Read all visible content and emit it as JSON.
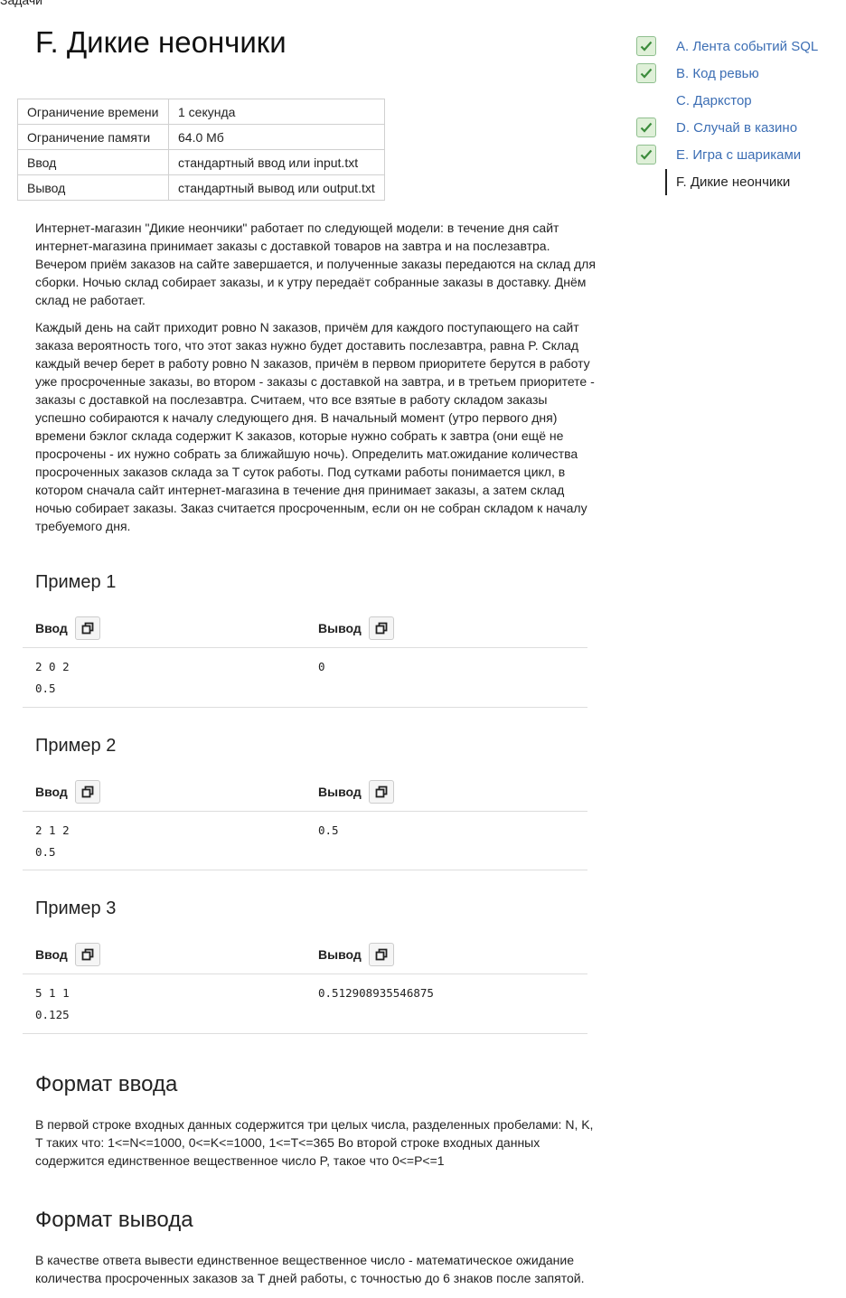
{
  "breadcrumb": "Задачи",
  "title": "F. Дикие неончики",
  "limits": [
    {
      "key": "Ограничение времени",
      "value": "1 секунда"
    },
    {
      "key": "Ограничение памяти",
      "value": "64.0 Мб"
    },
    {
      "key": "Ввод",
      "value": "стандартный ввод или input.txt"
    },
    {
      "key": "Вывод",
      "value": "стандартный вывод или output.txt"
    }
  ],
  "statement": [
    "Интернет-магазин \"Дикие неончики\" работает по следующей модели: в течение дня сайт интернет-магазина принимает заказы с доставкой товаров на завтра и на послезавтра. Вечером приём заказов на сайте завершается, и полученные заказы передаются на склад для сборки. Ночью склад собирает заказы, и к утру передаёт собранные заказы в доставку. Днём склад не работает.",
    "Каждый день на сайт приходит ровно N заказов, причём для каждого поступающего на сайт заказа вероятность того, что этот заказ нужно будет доставить послезавтра, равна P. Склад каждый вечер берет в работу ровно N заказов, причём в первом приоритете берутся в работу уже просроченные заказы, во втором - заказы с доставкой на завтра, и в третьем приоритете - заказы с доставкой на послезавтра. Считаем, что все взятые в работу складом заказы успешно собираются к началу следующего дня. В начальный момент (утро первого дня) времени бэклог склада содержит K заказов, которые нужно собрать к завтра (они ещё не просрочены - их нужно собрать за ближайшую ночь). Определить мат.ожидание количества просроченных заказов склада за T суток работы. Под сутками работы понимается цикл, в котором сначала сайт интернет-магазина в течение дня принимает заказы, а затем склад ночью собирает заказы. Заказ считается просроченным, если он не собран складом к началу требуемого дня."
  ],
  "io_labels": {
    "input": "Ввод",
    "output": "Вывод"
  },
  "examples": [
    {
      "title": "Пример 1",
      "input": [
        "2 0 2",
        "0.5"
      ],
      "output": [
        "0"
      ]
    },
    {
      "title": "Пример 2",
      "input": [
        "2 1 2",
        "0.5"
      ],
      "output": [
        "0.5"
      ]
    },
    {
      "title": "Пример 3",
      "input": [
        "5 1 1",
        "0.125"
      ],
      "output": [
        "0.512908935546875"
      ]
    }
  ],
  "input_format": {
    "heading": "Формат ввода",
    "text": "В первой строке входных данных содержится три целых числа, разделенных пробелами: N, K, T таких что: 1<=N<=1000, 0<=K<=1000, 1<=T<=365 Во второй строке входных данных содержится единственное вещественное число P, такое что 0<=P<=1"
  },
  "output_format": {
    "heading": "Формат вывода",
    "text": "В качестве ответа вывести единственное вещественное число - математическое ожидание количества просроченных заказов за T дней работы, с точностью до 6 знаков после запятой."
  },
  "sidebar": [
    {
      "label": "A. Лента событий SQL",
      "solved": true
    },
    {
      "label": "B. Код ревью",
      "solved": true
    },
    {
      "label": "C. Даркстор",
      "solved": false
    },
    {
      "label": "D. Случай в казино",
      "solved": true
    },
    {
      "label": "E. Игра с шариками",
      "solved": true
    },
    {
      "label": "F. Дикие неончики",
      "solved": false,
      "active": true
    }
  ],
  "colors": {
    "link": "#3c6eb4",
    "check_bg": "#dff0d8",
    "check_mark": "#3c8c3c"
  }
}
